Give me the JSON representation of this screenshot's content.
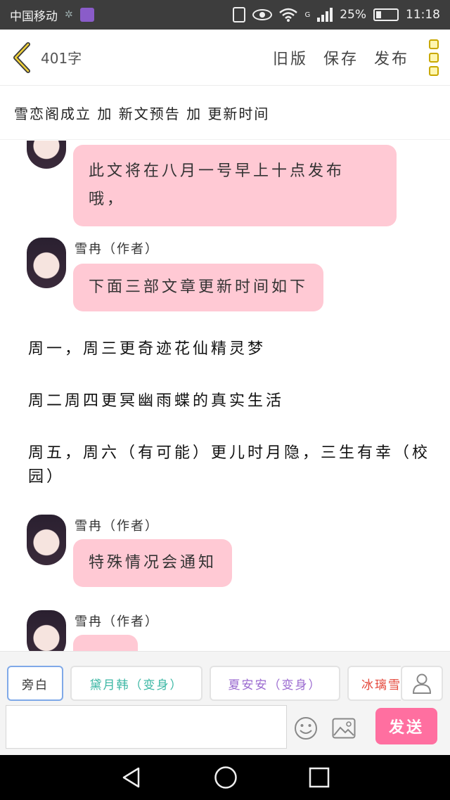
{
  "status_bar": {
    "carrier": "中国移动",
    "network_label": "G",
    "battery": "25%",
    "time": "11:18",
    "battery_fraction": 0.25
  },
  "top_bar": {
    "word_count": "401字",
    "old_version": "旧版",
    "save": "保存",
    "publish": "发布"
  },
  "chapter_title": "雪恋阁成立 加 新文预告 加 更新时间",
  "messages": [
    {
      "type": "bubble",
      "text": "此文将在八月一号早上十点发布哦，",
      "lines": [
        "此文将在八月一号早上十点发布",
        "哦，"
      ]
    },
    {
      "type": "bubble",
      "author": "雪冉（作者）",
      "text": "下面三部文章更新时间如下"
    },
    {
      "type": "narration",
      "text": "周一，周三更奇迹花仙精灵梦"
    },
    {
      "type": "narration",
      "text": "周二周四更冥幽雨蝶的真实生活"
    },
    {
      "type": "narration",
      "text": "周五，周六（有可能）更儿时月隐，三生有幸（校园）"
    },
    {
      "type": "bubble",
      "author": "雪冉（作者）",
      "text": "特殊情况会通知"
    },
    {
      "type": "bubble",
      "author": "雪冉（作者）",
      "text": ""
    }
  ],
  "characters": [
    {
      "label": "旁白",
      "color": "#333333"
    },
    {
      "label": "黛月韩（变身）",
      "color": "#3bb7a4"
    },
    {
      "label": "夏安安（变身）",
      "color": "#9b6bd0"
    },
    {
      "label": "冰璃雪",
      "color": "#e4473a"
    }
  ],
  "composer": {
    "placeholder": "",
    "send_label": "发送"
  },
  "colors": {
    "bubble": "#ffc9d4",
    "send_button": "#ff6fa0",
    "status_bar": "#3d3d3d"
  },
  "icons": [
    "back-icon",
    "more-icon",
    "user-icon",
    "emoji-icon",
    "image-icon",
    "nav-back-icon",
    "nav-home-icon",
    "nav-recent-icon"
  ]
}
